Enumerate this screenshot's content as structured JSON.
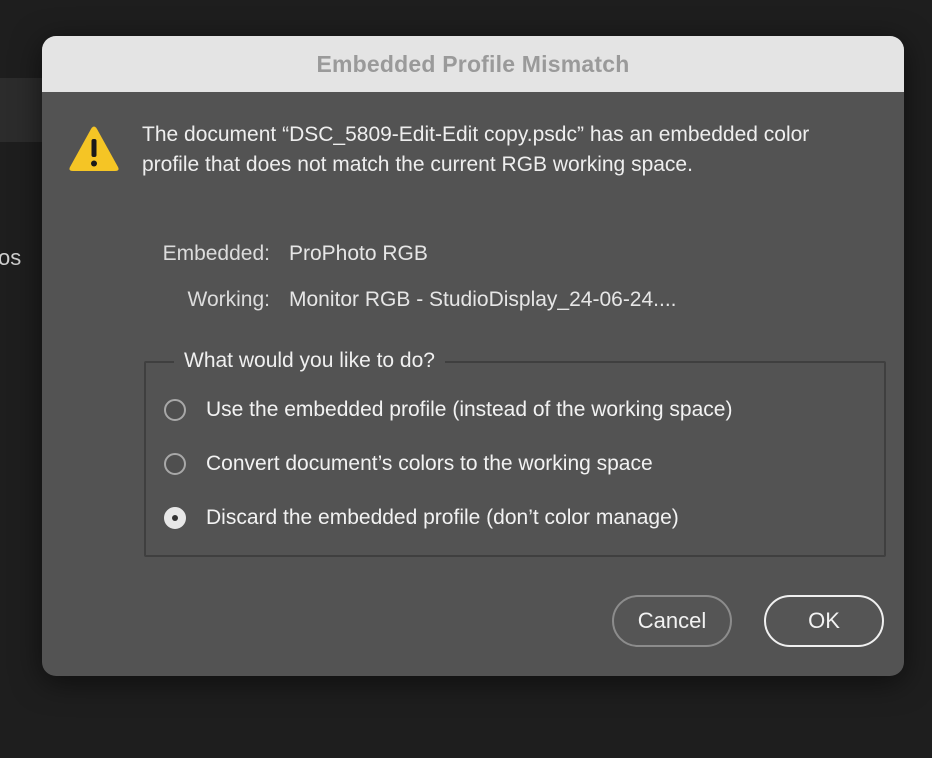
{
  "background": {
    "partial_text": "os"
  },
  "dialog": {
    "title": "Embedded Profile Mismatch",
    "icon": "warning-icon",
    "message": "The document “DSC_5809-Edit-Edit copy.psdc” has an embedded color profile that does not match the current RGB working space.",
    "embedded_label": "Embedded:",
    "embedded_value": "ProPhoto RGB",
    "working_label": "Working:",
    "working_value": "Monitor RGB - StudioDisplay_24-06-24....",
    "group_legend": "What would you like to do?",
    "options": [
      {
        "label": "Use the embedded profile (instead of the working space)",
        "checked": false
      },
      {
        "label": "Convert document’s colors to the working space",
        "checked": false
      },
      {
        "label": "Discard the embedded profile (don’t color manage)",
        "checked": true
      }
    ],
    "cancel_label": "Cancel",
    "ok_label": "OK"
  },
  "colors": {
    "dialog_bg": "#535353",
    "titlebar_bg": "#e4e4e4",
    "warning_yellow": "#f5c525"
  }
}
